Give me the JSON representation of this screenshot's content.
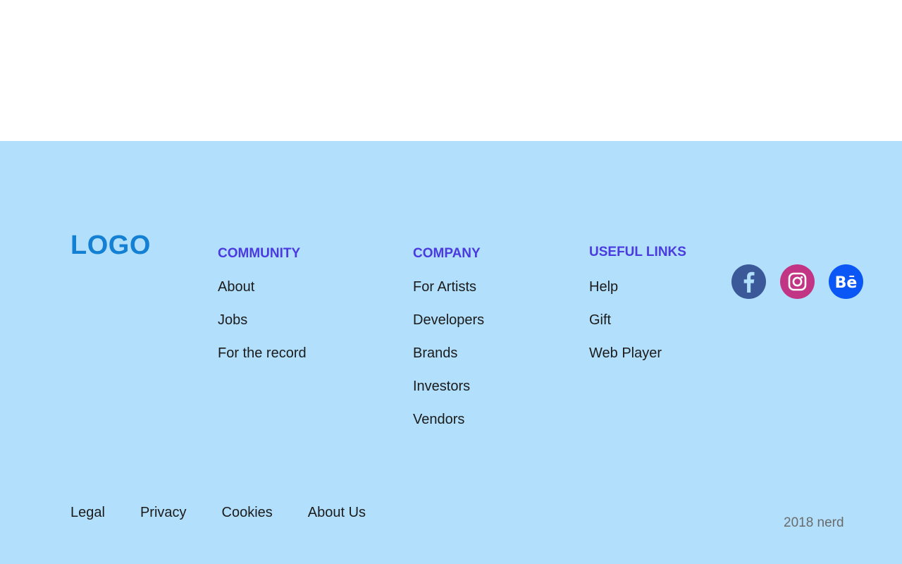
{
  "logo": {
    "text": "LOGO",
    "color": "#1480d4"
  },
  "footer": {
    "background": "#b2e0fc",
    "heading_color": "#4a3ae0",
    "columns": [
      {
        "heading": "COMMUNITY",
        "links": [
          "About",
          "Jobs",
          "For the record"
        ]
      },
      {
        "heading": "COMPANY",
        "links": [
          "For Artists",
          "Developers",
          "Brands",
          "Investors",
          "Vendors"
        ]
      },
      {
        "heading": "USEFUL LINKS",
        "links": [
          "Help",
          "Gift",
          "Web Player"
        ]
      }
    ],
    "social": [
      {
        "name": "facebook-icon",
        "color": "#3b5998"
      },
      {
        "name": "instagram-icon",
        "color": "#c13584"
      },
      {
        "name": "behance-icon",
        "color": "#0a57f5"
      }
    ],
    "bottom_links": [
      "Legal",
      "Privacy",
      "Cookies",
      "About Us"
    ],
    "copyright": "2018 nerd"
  }
}
